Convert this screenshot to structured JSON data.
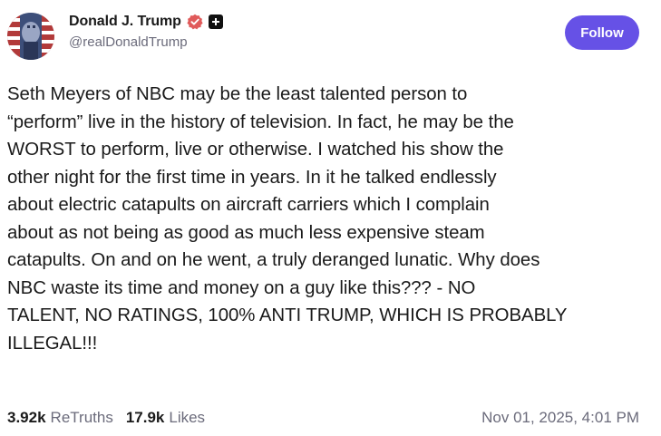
{
  "author": {
    "display_name": "Donald J. Trump",
    "handle": "@realDonaldTrump",
    "verified_icon": "verified-badge-icon",
    "badge_icon": "plus-badge-icon"
  },
  "follow_button": {
    "label": "Follow",
    "color": "#6651e6"
  },
  "post": {
    "text": "Seth Meyers of NBC may be the least talented person to\n“perform” live in the history of television. In fact, he may be the\nWORST to perform, live or otherwise. I watched his show the\nother night for the first time in years. In it he talked endlessly\nabout electric catapults on aircraft carriers which I complain\nabout as not being as good as much less expensive steam\ncatapults. On and on he went, a truly deranged lunatic. Why does\nNBC waste its time and money on a guy like this??? - NO\nTALENT, NO RATINGS, 100% ANTI TRUMP, WHICH IS PROBABLY\nILLEGAL!!!"
  },
  "stats": {
    "retruths_count": "3.92k",
    "retruths_label": "ReTruths",
    "likes_count": "17.9k",
    "likes_label": "Likes",
    "timestamp": "Nov 01, 2025, 4:01 PM"
  },
  "colors": {
    "text": "#1a1a1a",
    "muted": "#6b6b7b",
    "verified": "#e05a5a"
  }
}
